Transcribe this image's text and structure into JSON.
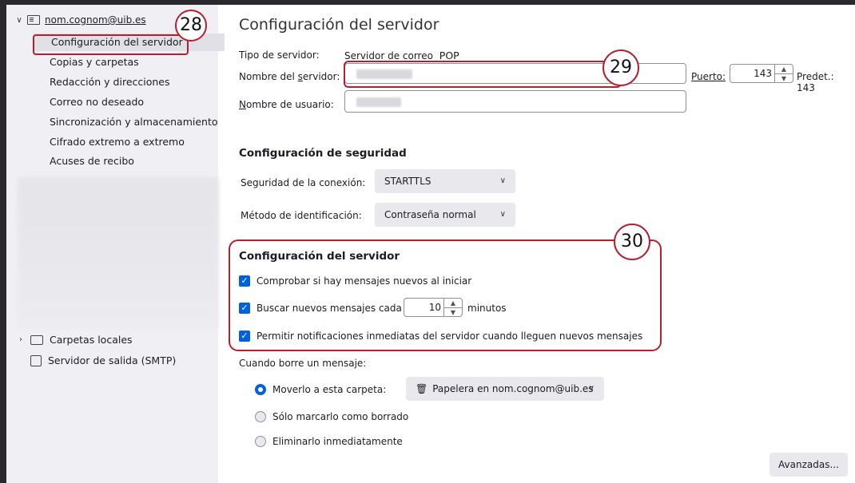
{
  "sidebar": {
    "account": "nom.cognom@uib.es",
    "items": [
      {
        "label": "Configuración del servidor"
      },
      {
        "label": "Copias y carpetas"
      },
      {
        "label": "Redacción y direcciones"
      },
      {
        "label": "Correo no deseado"
      },
      {
        "label": "Sincronización y almacenamiento"
      },
      {
        "label": "Cifrado extremo a extremo"
      },
      {
        "label": "Acuses de recibo"
      }
    ],
    "local_folders": "Carpetas locales",
    "smtp": "Servidor de salida (SMTP)"
  },
  "main": {
    "title": "Configuración del servidor",
    "server_type_label": "Tipo de servidor:",
    "server_type_value": "Servidor de correo",
    "server_type_proto": "POP",
    "server_name_pre": "Nombre del ",
    "server_name_u": "s",
    "server_name_post": "ervidor:",
    "port_label": "Puerto:",
    "port_value": "143",
    "default_label": "Predet.: 143",
    "username_u": "N",
    "username_post": "ombre de usuario:",
    "security_heading": "Configuración de seguridad",
    "conn_security_label": "Seguridad de la conexión:",
    "conn_security_value": "STARTTLS",
    "auth_label": "Método de identificación:",
    "auth_value": "Contraseña normal",
    "server_settings_heading": "Configuración del servidor",
    "check_on_start": "Comprobar si hay mensajes nuevos al iniciar",
    "check_every_pre": "Buscar nuevos mensajes cada",
    "check_every_value": "10",
    "check_every_post": "minutos",
    "allow_push": "Permitir notificaciones inmediatas del servidor cuando lleguen nuevos mensajes",
    "delete_label": "Cuando borre un mensaje:",
    "move_label": "Moverlo a esta carpeta:",
    "trash_folder": "Papelera en nom.cognom@uib.es",
    "mark_label": "Sólo marcarlo como borrado",
    "remove_label": "Eliminarlo inmediatamente",
    "advanced_button": "Avanzadas..."
  },
  "annotations": {
    "badge_28": "28",
    "badge_29": "29",
    "badge_30": "30"
  }
}
